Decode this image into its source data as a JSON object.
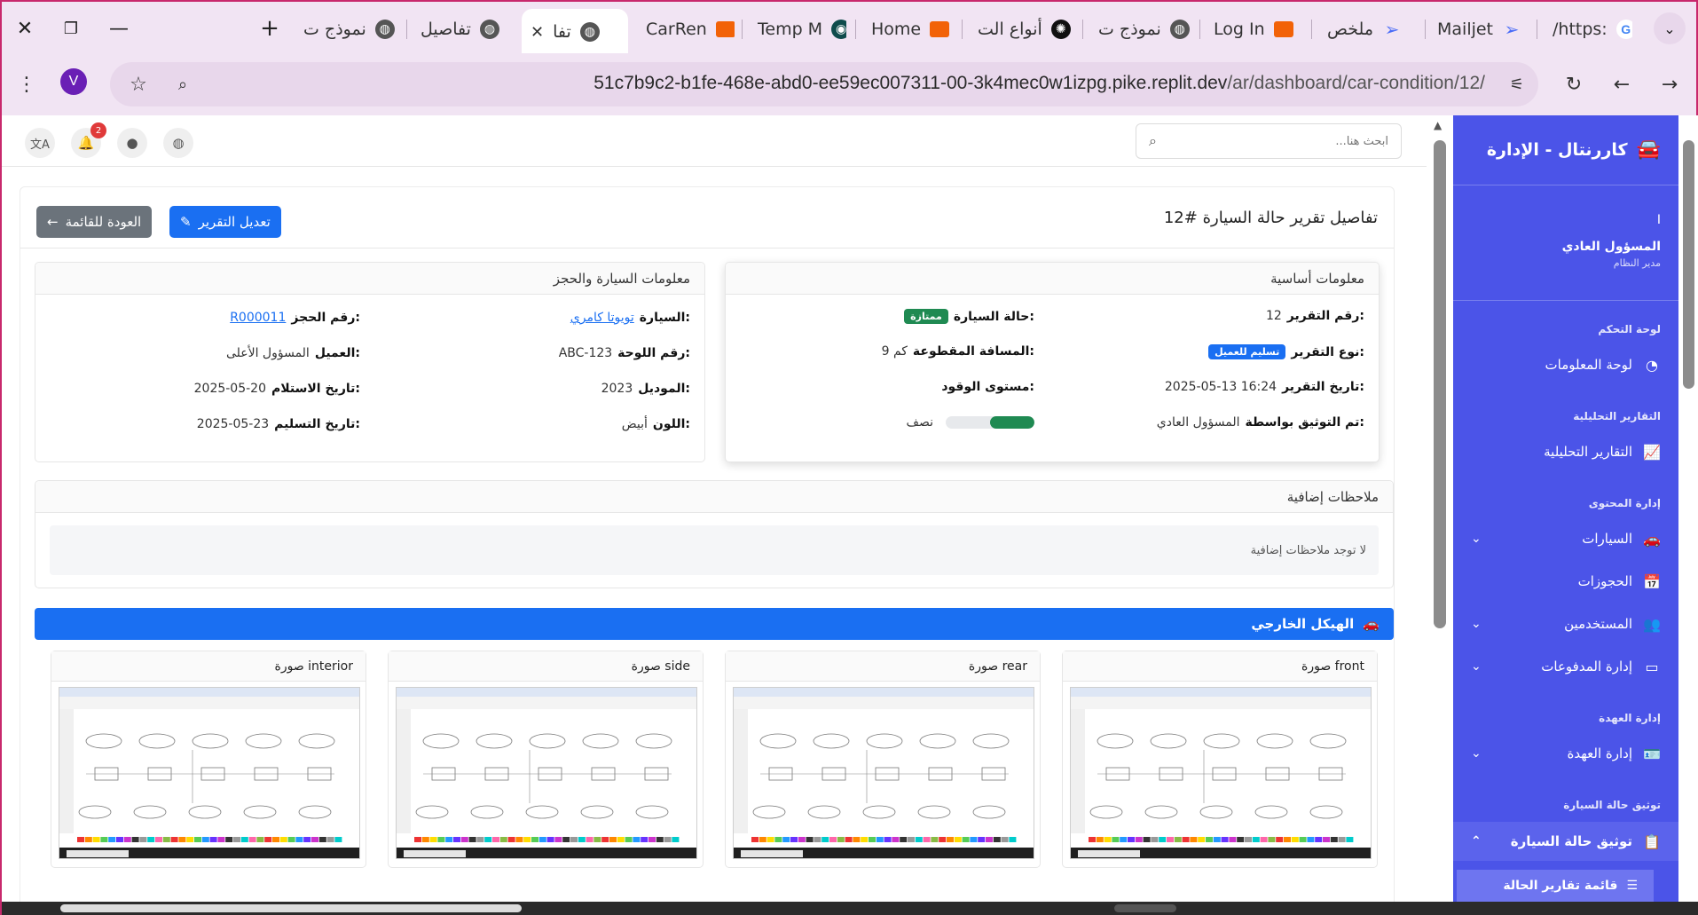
{
  "browser": {
    "tabs": [
      {
        "title": "/https:",
        "icon": "google-icon"
      },
      {
        "title": "Mailjet",
        "icon": "send-icon"
      },
      {
        "title": "ملخص",
        "icon": "send-icon"
      },
      {
        "title": "Log In",
        "icon": "replit-icon"
      },
      {
        "title": "نموذج ت",
        "icon": "globe-icon"
      },
      {
        "title": "أنواع الت",
        "icon": "openai-icon"
      },
      {
        "title": "Home",
        "icon": "replit-icon"
      },
      {
        "title": "Temp M",
        "icon": "app-icon"
      },
      {
        "title": "CarRen",
        "icon": "replit-icon"
      },
      {
        "title": "تفا",
        "icon": "globe-icon",
        "active": true
      },
      {
        "title": "تفاصيل",
        "icon": "globe-icon"
      },
      {
        "title": "نموذج ت",
        "icon": "globe-icon"
      }
    ],
    "url_main": "51c7b9c2-b1fe-468e-abd0-ee59ec007311-00-3k4mec0w1izpg.pike.replit.dev",
    "url_path": "/ar/dashboard/car-condition/12/",
    "profile_initial": "V"
  },
  "sidebar": {
    "brand": "كاررنتال - الإدارة",
    "user_mark": "I",
    "user_name": "المسؤول العادي",
    "user_role": "مدير النظام",
    "sections": {
      "dashboard": "لوحة التحكم",
      "reports": "التقارير التحليلية",
      "content": "إدارة المحتوى",
      "custody": "إدارة العهدة",
      "condition": "توثيق حالة السيارة"
    },
    "items": {
      "info_board": "لوحة المعلومات",
      "analytics": "التقارير التحليلية",
      "cars": "السيارات",
      "bookings": "الحجوزات",
      "users": "المستخدمين",
      "payments": "إدارة المدفوعات",
      "custody": "إدارة العهدة",
      "condition": "توثيق حالة السيارة",
      "condition_list": "قائمة تقارير الحالة"
    }
  },
  "header": {
    "search_placeholder": "ابحث هنا...",
    "notifications_count": "2"
  },
  "page": {
    "title": "تفاصيل تقرير حالة السيارة #12",
    "edit_button": "تعديل التقرير",
    "back_button": "العودة للقائمة",
    "basic_info": {
      "heading": "معلومات أساسية",
      "report_no_label": "رقم التقرير:",
      "report_no": "12",
      "report_type_label": "نوع التقرير:",
      "report_type": "تسليم للعميل",
      "report_date_label": "تاريخ التقرير:",
      "report_date": "2025-05-13 16:24",
      "documented_by_label": "تم التوثيق بواسطة:",
      "documented_by": "المسؤول العادي",
      "condition_label": "حالة السيارة:",
      "condition": "ممتازة",
      "mileage_label": "المسافة المقطوعة:",
      "mileage": "9 كم",
      "fuel_label": "مستوى الوقود:",
      "fuel_text": "نصف",
      "fuel_level": 0.5
    },
    "car_booking": {
      "heading": "معلومات السيارة والحجز",
      "car_label": "السيارة:",
      "car": "تويوتا كامري",
      "plate_label": "رقم اللوحة:",
      "plate": "ABC-123",
      "model_label": "الموديل:",
      "model": "2023",
      "color_label": "اللون:",
      "color": "أبيض",
      "booking_label": "رقم الحجز:",
      "booking": "R000011",
      "customer_label": "العميل:",
      "customer": "المسؤول الأعلى",
      "pickup_label": "تاريخ الاستلام:",
      "pickup": "2025-05-20",
      "return_label": "تاريخ التسليم:",
      "return": "2025-05-23"
    },
    "notes": {
      "heading": "ملاحظات إضافية",
      "text": "لا توجد ملاحظات إضافية"
    },
    "exterior": {
      "heading": "الهيكل الخارجي",
      "photos": [
        {
          "label": "صورة front"
        },
        {
          "label": "صورة rear"
        },
        {
          "label": "صورة side"
        },
        {
          "label": "صورة interior"
        }
      ]
    }
  },
  "colors": {
    "sidebar": "#4b54e8",
    "primary": "#1a6ff2",
    "success": "#1f8a52",
    "secondary": "#6b737b"
  }
}
